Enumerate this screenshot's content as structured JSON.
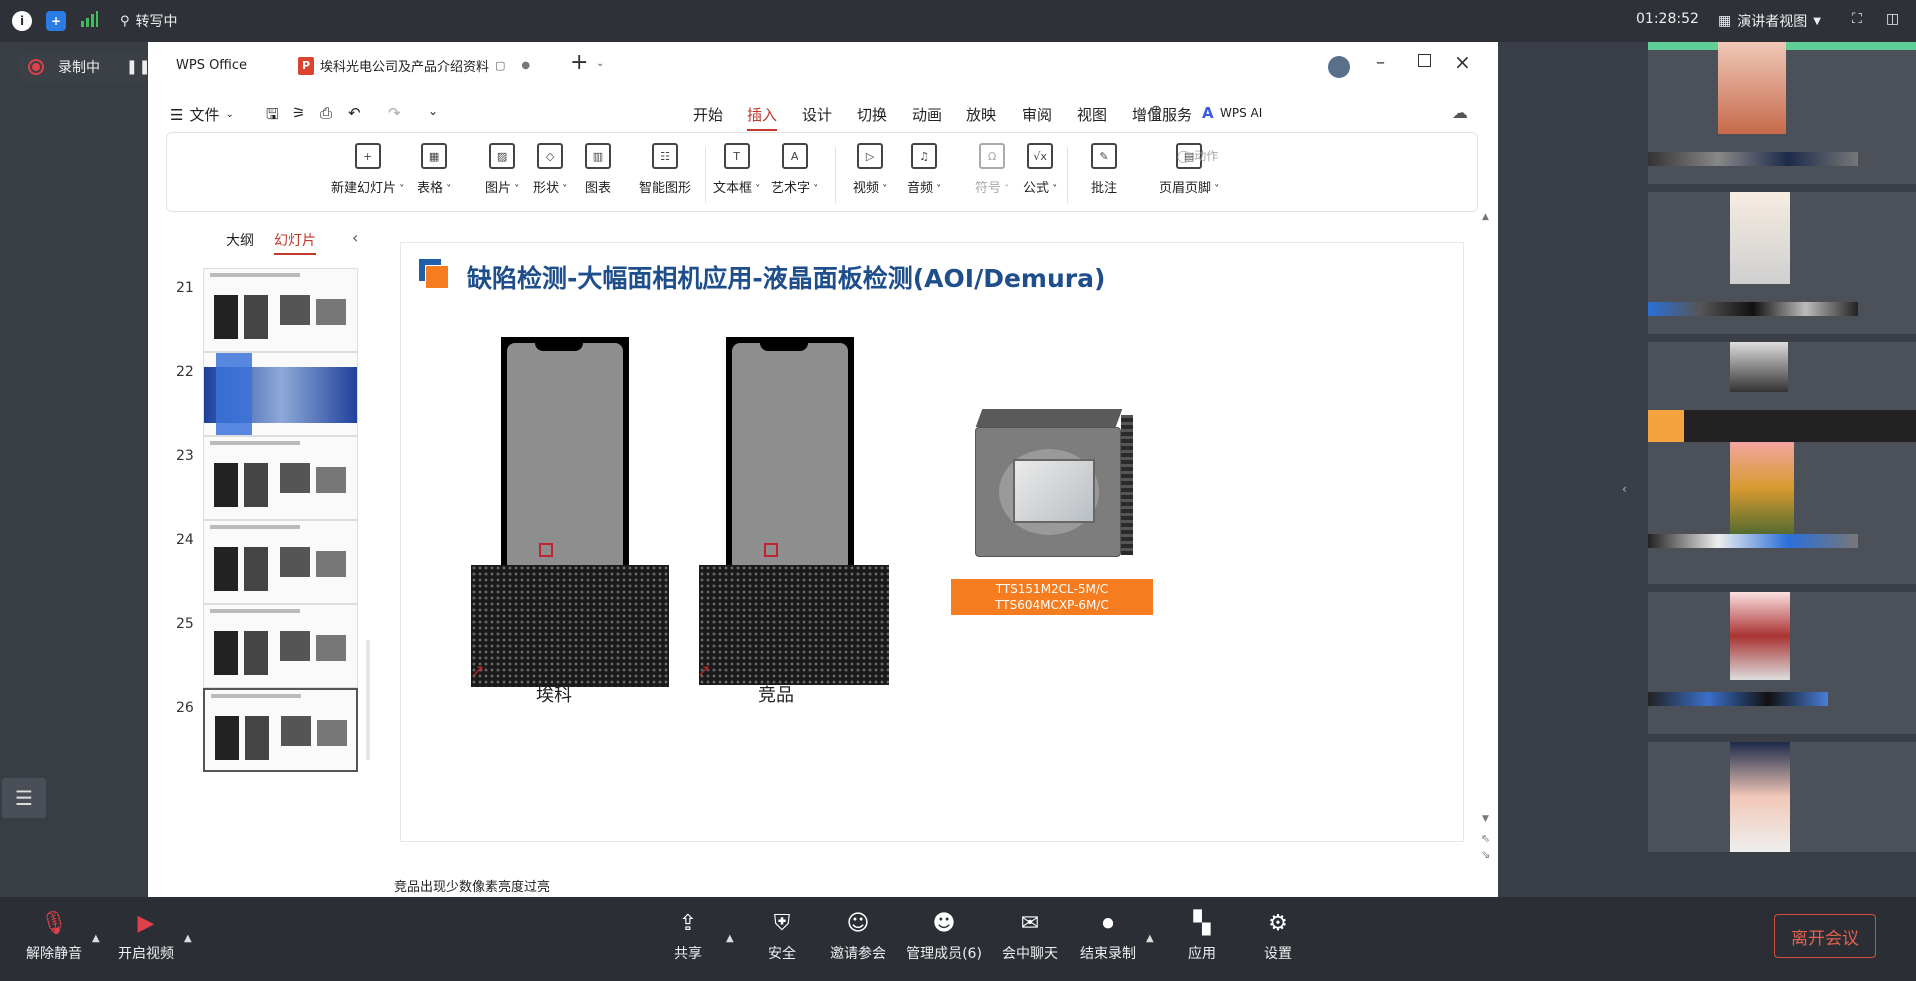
{
  "system_bar": {
    "transcribing": "转写中",
    "time": "01:28:52",
    "view_mode": "演讲者视图"
  },
  "recording": {
    "label": "录制中"
  },
  "wps": {
    "app_tab": "WPS Office",
    "doc_tab": "埃科光电公司及产品介绍资料",
    "file_menu": "文件",
    "menu_tabs": [
      "开始",
      "插入",
      "设计",
      "切换",
      "动画",
      "放映",
      "审阅",
      "视图",
      "增值服务",
      "WPS AI"
    ],
    "active_tab_index": 1,
    "ribbon": [
      {
        "label": "新建幻灯片",
        "icon": "new-slide-icon",
        "caret": true
      },
      {
        "label": "表格",
        "icon": "table-icon",
        "caret": true
      },
      {
        "label": "图片",
        "icon": "picture-icon",
        "caret": true
      },
      {
        "label": "形状",
        "icon": "shape-icon",
        "caret": true
      },
      {
        "label": "图表",
        "icon": "chart-icon",
        "caret": false
      },
      {
        "label": "智能图形",
        "icon": "smartart-icon",
        "caret": false
      },
      {
        "label": "文本框",
        "icon": "textbox-icon",
        "caret": true
      },
      {
        "label": "艺术字",
        "icon": "wordart-icon",
        "caret": true
      },
      {
        "label": "视频",
        "icon": "video-icon",
        "caret": true
      },
      {
        "label": "音频",
        "icon": "audio-icon",
        "caret": true
      },
      {
        "label": "符号",
        "icon": "symbol-icon",
        "caret": true,
        "disabled": true
      },
      {
        "label": "公式",
        "icon": "formula-icon",
        "caret": true
      },
      {
        "label": "批注",
        "icon": "comment-icon",
        "caret": false
      },
      {
        "label": "页眉页脚",
        "icon": "header-footer-icon",
        "caret": true
      }
    ],
    "action_label": "动作",
    "panel_tabs": [
      "大纲",
      "幻灯片"
    ],
    "active_panel_tab": 1,
    "thumbnails": [
      "21",
      "22",
      "23",
      "24",
      "25",
      "26"
    ],
    "selected_thumbnail": "26"
  },
  "slide": {
    "title": "缺陷检测-大幅面相机应用-液晶面板检测(AOI/Demura)",
    "label_left": "埃科",
    "label_right": "竞品",
    "camera_models_line1": "TTS151M2CL-5M/C",
    "camera_models_line2": "TTS604MCXP-6M/C"
  },
  "notes": "竞品出现少数像素亮度过亮",
  "bottom_bar": {
    "buttons": [
      "解除静音",
      "开启视频",
      "共享",
      "安全",
      "邀请参会",
      "管理成员(6)",
      "会中聊天",
      "结束录制",
      "应用",
      "设置"
    ],
    "leave": "离开会议"
  },
  "colors": {
    "accent_orange": "#f57c1f",
    "title_blue": "#1f4e8c",
    "leave_red": "#d4503d",
    "active_tab_red": "#c0392b"
  }
}
